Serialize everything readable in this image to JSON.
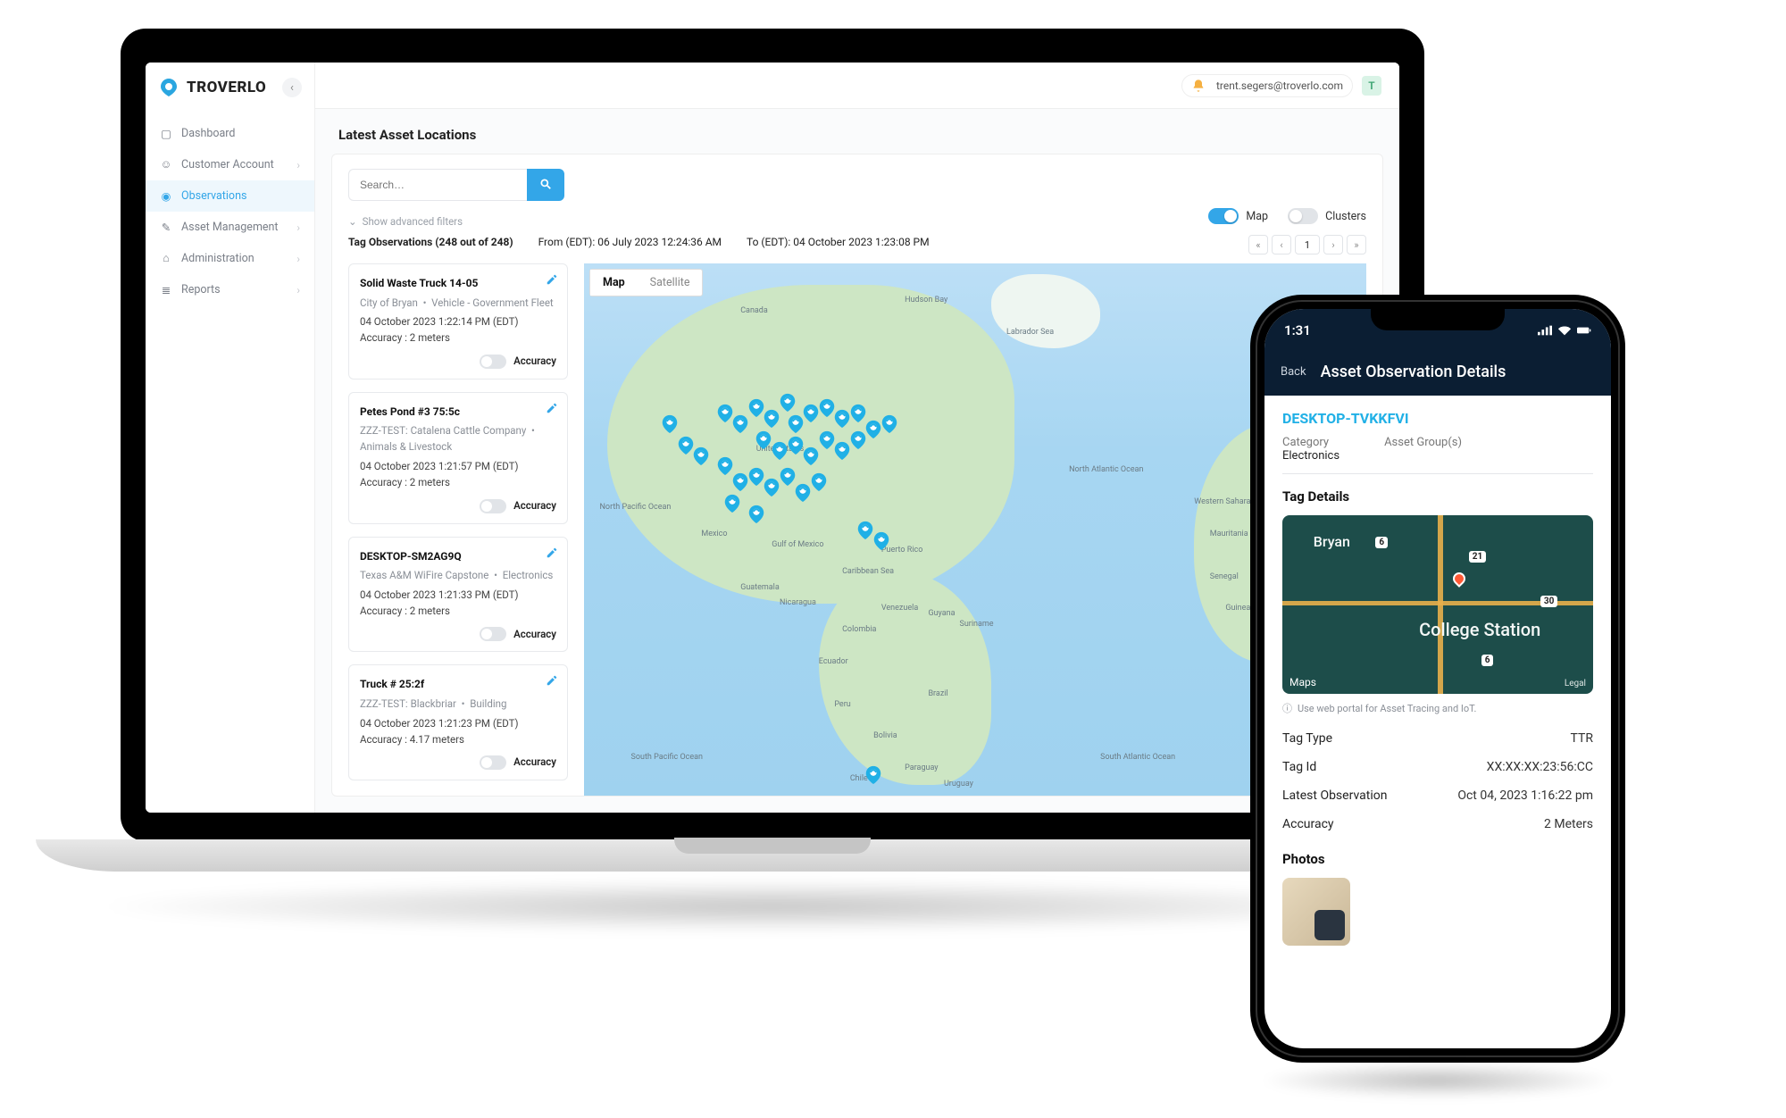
{
  "brand": {
    "name": "TROVERLO"
  },
  "user": {
    "email": "trent.segers@troverlo.com",
    "initial": "T"
  },
  "nav": {
    "items": [
      {
        "label": "Dashboard",
        "has_children": false,
        "active": false
      },
      {
        "label": "Customer Account",
        "has_children": true,
        "active": false
      },
      {
        "label": "Observations",
        "has_children": false,
        "active": true
      },
      {
        "label": "Asset Management",
        "has_children": true,
        "active": false
      },
      {
        "label": "Administration",
        "has_children": true,
        "active": false
      },
      {
        "label": "Reports",
        "has_children": true,
        "active": false
      }
    ]
  },
  "page": {
    "title": "Latest Asset Locations",
    "search_placeholder": "Search…",
    "advanced_filters_label": "Show advanced filters",
    "toggles": {
      "map": "Map",
      "clusters": "Clusters",
      "map_on": true,
      "clusters_on": false
    },
    "obs_heading": "Tag Observations (248 out of 248)",
    "from_label": "From (EDT): 06 July 2023 12:24:36 AM",
    "to_label": "To (EDT): 04 October 2023 1:23:08 PM",
    "pager": {
      "first": "«",
      "prev": "‹",
      "current": "1",
      "next": "›",
      "last": "»"
    },
    "map_types": {
      "map": "Map",
      "satellite": "Satellite"
    }
  },
  "observations": [
    {
      "title": "Solid Waste Truck 14-05",
      "org": "City of Bryan",
      "type": "Vehicle - Government Fleet",
      "timestamp": "04 October 2023 1:22:14 PM (EDT)",
      "accuracy": "Accuracy : 2 meters",
      "toggle_label": "Accuracy"
    },
    {
      "title": "Petes Pond #3 75:5c",
      "org": "ZZZ-TEST: Catalena Cattle Company",
      "type": "Animals & Livestock",
      "timestamp": "04 October 2023 1:21:57 PM (EDT)",
      "accuracy": "Accuracy : 2 meters",
      "toggle_label": "Accuracy"
    },
    {
      "title": "DESKTOP-SM2AG9Q",
      "org": "Texas A&M WiFire Capstone",
      "type": "Electronics",
      "timestamp": "04 October 2023 1:21:33 PM (EDT)",
      "accuracy": "Accuracy : 2 meters",
      "toggle_label": "Accuracy"
    },
    {
      "title": "Truck # 25:2f",
      "org": "ZZZ-TEST: Blackbriar",
      "type": "Building",
      "timestamp": "04 October 2023 1:21:23 PM (EDT)",
      "accuracy": "Accuracy : 4.17 meters",
      "toggle_label": "Accuracy"
    }
  ],
  "map_labels": {
    "canada": "Canada",
    "united_states": "United States",
    "mexico": "Mexico",
    "gulf": "Gulf of Mexico",
    "caribbean": "Caribbean Sea",
    "puerto_rico": "Puerto Rico",
    "guatemala": "Guatemala",
    "nicaragua": "Nicaragua",
    "venezuela": "Venezuela",
    "colombia": "Colombia",
    "guyana": "Guyana",
    "suriname": "Suriname",
    "ecuador": "Ecuador",
    "peru": "Peru",
    "brazil": "Brazil",
    "bolivia": "Bolivia",
    "chile": "Chile",
    "paraguay": "Paraguay",
    "uruguay": "Uruguay",
    "n_pacific": "North Pacific Ocean",
    "s_pacific": "South Pacific Ocean",
    "n_atlantic": "North Atlantic Ocean",
    "s_atlantic": "South Atlantic Ocean",
    "hudson": "Hudson Bay",
    "labrador": "Labrador Sea",
    "senegal": "Senegal",
    "guinea": "Guinea",
    "mauritania": "Mauritania",
    "w_sahara": "Western Sahara"
  },
  "phone": {
    "status_time": "1:31",
    "back": "Back",
    "header": "Asset Observation Details",
    "asset_id": "DESKTOP-TVKKFVI",
    "category_label": "Category",
    "category_value": "Electronics",
    "group_label": "Asset Group(s)",
    "tag_details": "Tag Details",
    "map": {
      "city1": "Bryan",
      "city2": "College Station",
      "roads": [
        "6",
        "30",
        "6",
        "21"
      ],
      "logo": "Maps",
      "legal": "Legal"
    },
    "portal_note": "Use web portal for Asset Tracing and IoT.",
    "rows": [
      {
        "k": "Tag Type",
        "v": "TTR"
      },
      {
        "k": "Tag Id",
        "v": "XX:XX:XX:23:56:CC"
      },
      {
        "k": "Latest Observation",
        "v": "Oct 04, 2023 1:16:22 pm"
      },
      {
        "k": "Accuracy",
        "v": "2 Meters"
      }
    ],
    "photos_label": "Photos"
  }
}
